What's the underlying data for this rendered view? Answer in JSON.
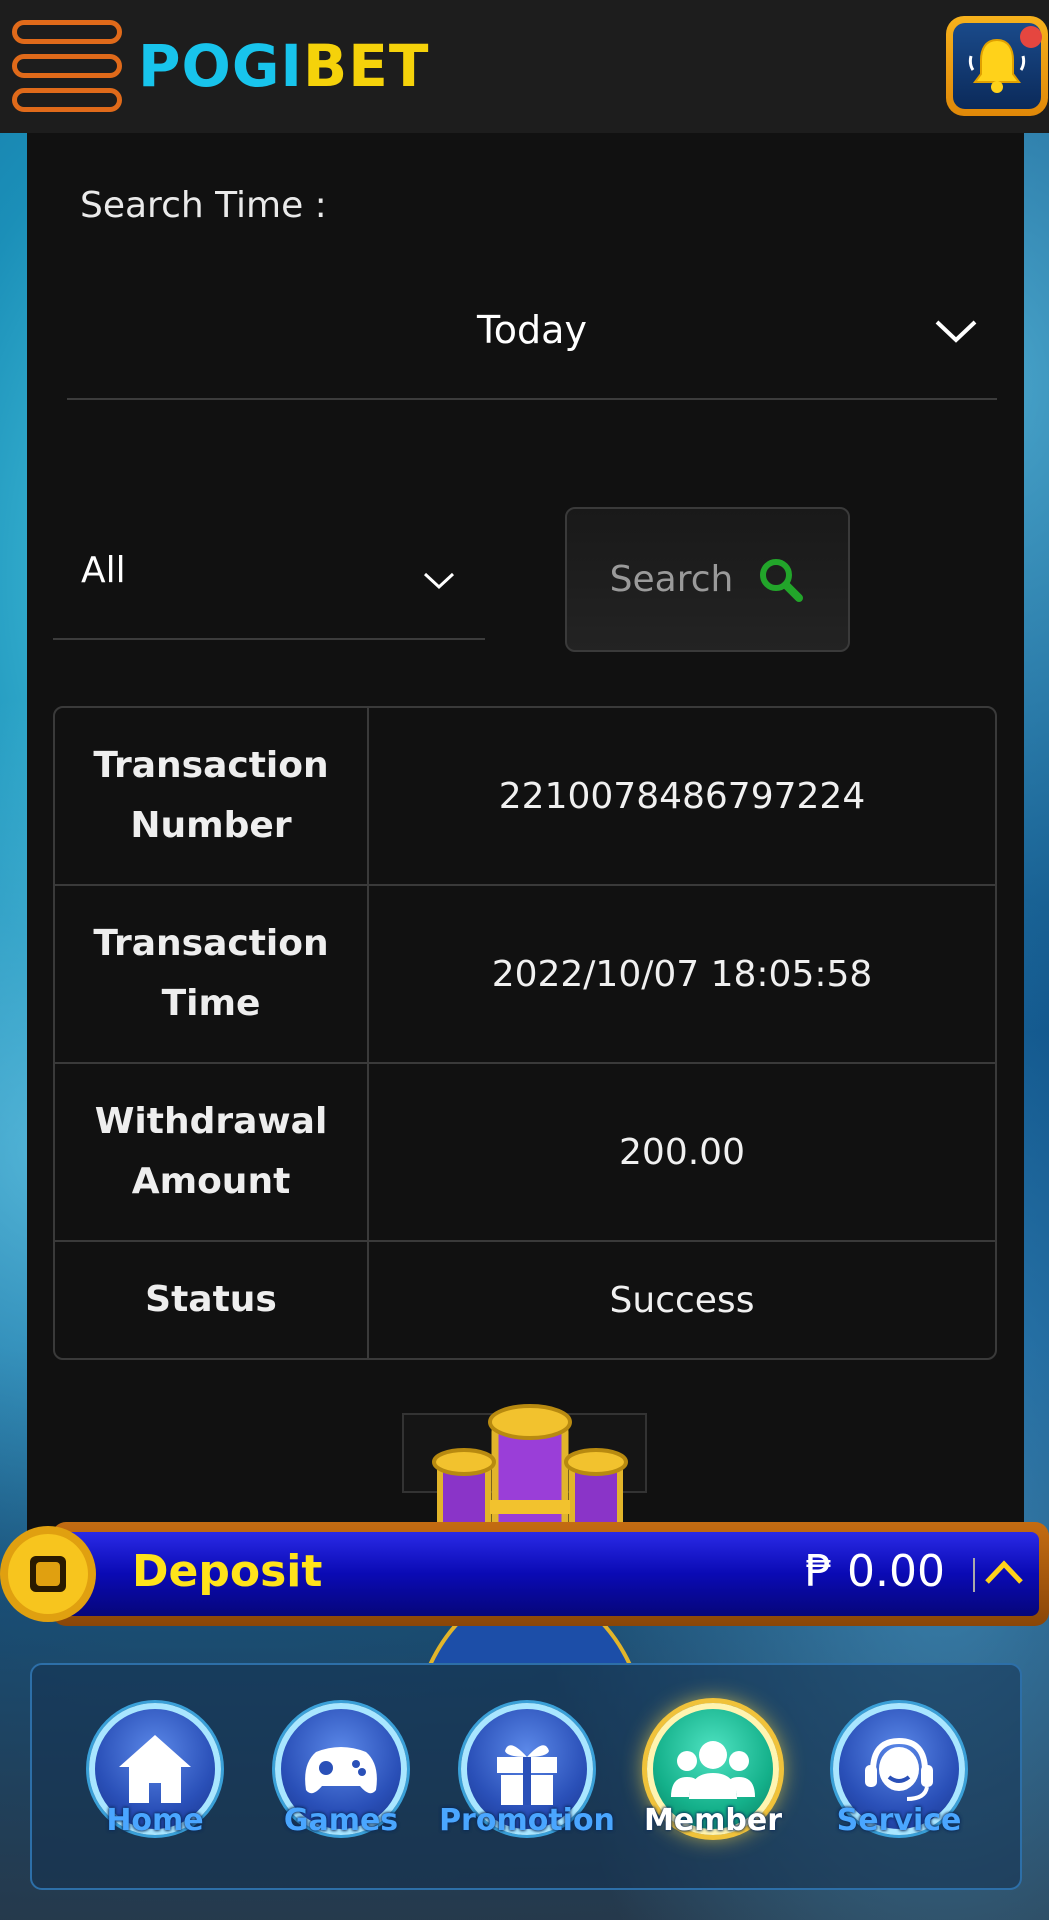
{
  "header": {
    "logo_part1": "POGI",
    "logo_part2": "BET"
  },
  "filters": {
    "search_time_label": "Search Time :",
    "period_value": "Today",
    "type_value": "All",
    "search_button_label": "Search"
  },
  "transaction": {
    "rows": [
      {
        "label": "Transaction Number",
        "value": "2210078486797224"
      },
      {
        "label": "Transaction Time",
        "value": "2022/10/07 18:05:58"
      },
      {
        "label": "Withdrawal Amount",
        "value": "200.00"
      },
      {
        "label": "Status",
        "value": "Success"
      }
    ]
  },
  "deposit_bar": {
    "label": "Deposit",
    "amount": "₱ 0.00"
  },
  "bottom_nav": {
    "items": [
      {
        "label": "Home",
        "icon": "home-icon"
      },
      {
        "label": "Games",
        "icon": "gamepad-icon"
      },
      {
        "label": "Promotion",
        "icon": "gift-icon"
      },
      {
        "label": "Member",
        "icon": "member-icon",
        "active": true
      },
      {
        "label": "Service",
        "icon": "headset-icon"
      }
    ]
  },
  "colors": {
    "header_bg": "#1d1d1d",
    "panel_bg": "#111111",
    "accent_orange": "#e06a1a",
    "logo_blue": "#18c4ec",
    "logo_yellow": "#f5d20a",
    "deposit_yellow": "#ffe31a",
    "search_icon_green": "#22a52a",
    "nav_label_blue": "#4aa6ff"
  }
}
